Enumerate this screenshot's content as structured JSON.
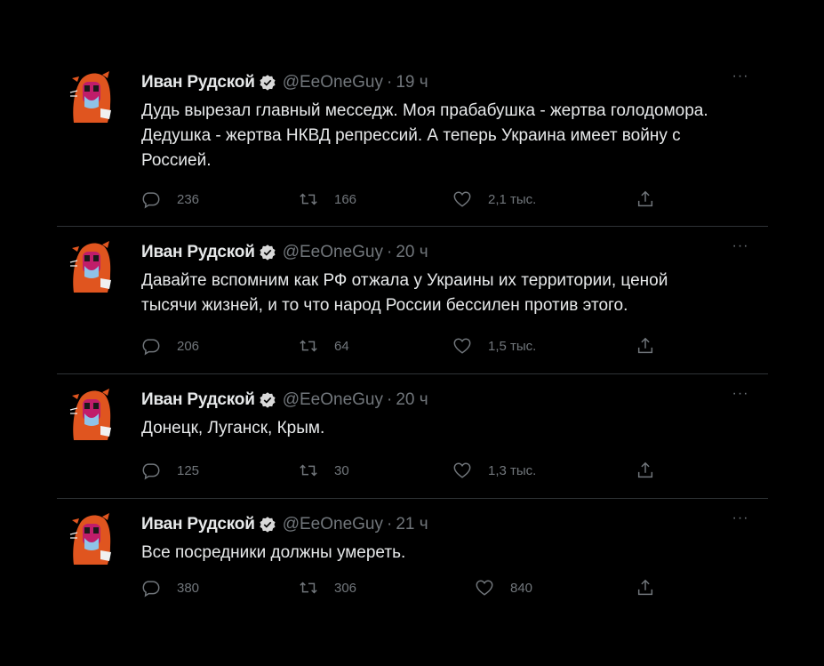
{
  "colors": {
    "background": "#000000",
    "text_primary": "#e7e9ea",
    "text_secondary": "#71767b",
    "divider": "#2f3336",
    "verified_badge": "#d9d9d9"
  },
  "icons": {
    "reply": "reply-icon",
    "retweet": "retweet-icon",
    "like": "like-icon",
    "share": "share-icon",
    "more": "more-icon",
    "verified": "verified-badge-icon"
  },
  "tweets": [
    {
      "name": "Иван Рудской",
      "handle": "@EeOneGuy",
      "separator": "·",
      "time": "19 ч",
      "text": "Дудь вырезал главный месседж. Моя прабабушка - жертва голодомора.\nДедушка - жертва НКВД репрессий. А теперь Украина имеет войну с\nРоссией.",
      "replies": "236",
      "retweets": "166",
      "likes": "2,1 тыс."
    },
    {
      "name": "Иван Рудской",
      "handle": "@EeOneGuy",
      "separator": "·",
      "time": "20 ч",
      "text": "Давайте вспомним как РФ отжала у Украины их территории, ценой\nтысячи жизней, и то что народ России бессилен против этого.",
      "replies": "206",
      "retweets": "64",
      "likes": "1,5 тыс."
    },
    {
      "name": "Иван Рудской",
      "handle": "@EeOneGuy",
      "separator": "·",
      "time": "20 ч",
      "text": "Донецк, Луганск, Крым.",
      "replies": "125",
      "retweets": "30",
      "likes": "1,3 тыс."
    },
    {
      "name": "Иван Рудской",
      "handle": "@EeOneGuy",
      "separator": "·",
      "time": "21 ч",
      "text": "Все посредники должны умереть.",
      "replies": "380",
      "retweets": "306",
      "likes": "840"
    }
  ]
}
